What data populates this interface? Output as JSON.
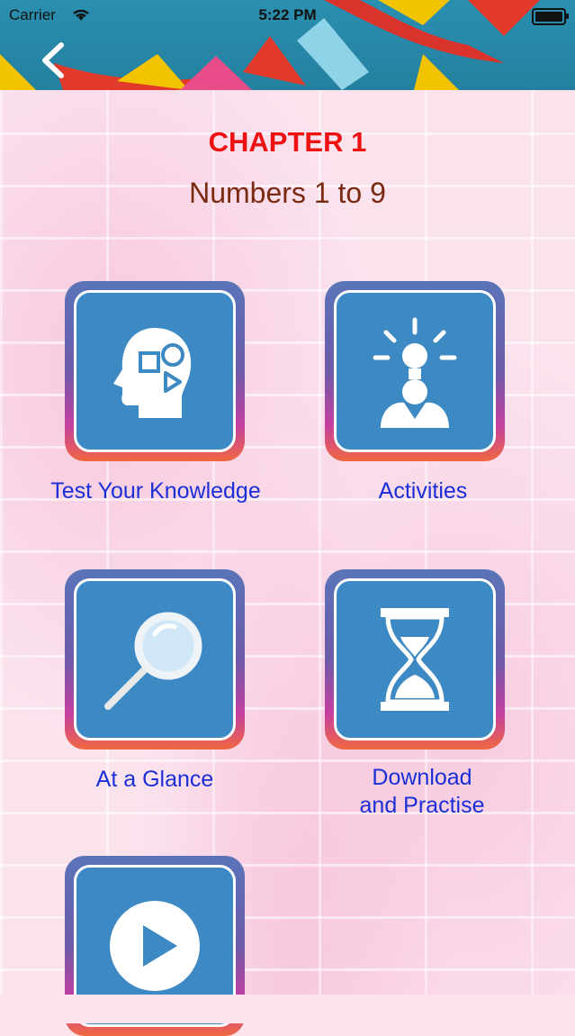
{
  "status_bar": {
    "carrier": "Carrier",
    "time": "5:22 PM"
  },
  "nav": {
    "back_icon": "chevron-left-icon"
  },
  "header": {
    "chapter": "CHAPTER 1",
    "subtitle": "Numbers 1 to 9"
  },
  "tiles": [
    {
      "label": "Test Your Knowledge",
      "icon": "head-shapes-icon"
    },
    {
      "label": "Activities",
      "icon": "lightbulb-person-icon"
    },
    {
      "label": "At a Glance",
      "icon": "magnifier-icon"
    },
    {
      "label_line1": "Download",
      "label_line2": "and Practise",
      "icon": "hourglass-icon"
    },
    {
      "label": "",
      "icon": "play-icon"
    }
  ],
  "colors": {
    "chapter": "#ee1111",
    "subtitle": "#7a2a10",
    "label": "#1a2fd8",
    "tile_bg": "#3c89c4"
  }
}
